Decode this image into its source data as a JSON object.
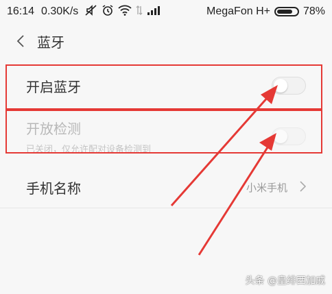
{
  "status_bar": {
    "time": "16:14",
    "speed": "0.30K/s",
    "carrier": "MegaFon H+",
    "battery": "78%",
    "battery_level": 0.78
  },
  "header": {
    "title": "蓝牙"
  },
  "settings": {
    "bluetooth": {
      "label": "开启蓝牙",
      "enabled": false
    },
    "discoverable": {
      "label": "开放检测",
      "sublabel": "已关闭，仅允许配对设备检测到",
      "enabled": false
    },
    "device_name": {
      "label": "手机名称",
      "value": "小米手机"
    }
  },
  "watermark": "头条 @皇绯西加戚",
  "colors": {
    "annotation": "#e53935",
    "background": "#f7f7f7"
  },
  "icons": [
    "mute-icon",
    "alarm-icon",
    "wifi-icon",
    "signal-icon",
    "battery-icon",
    "back-icon",
    "chevron-right-icon",
    "arrow-annotation"
  ]
}
